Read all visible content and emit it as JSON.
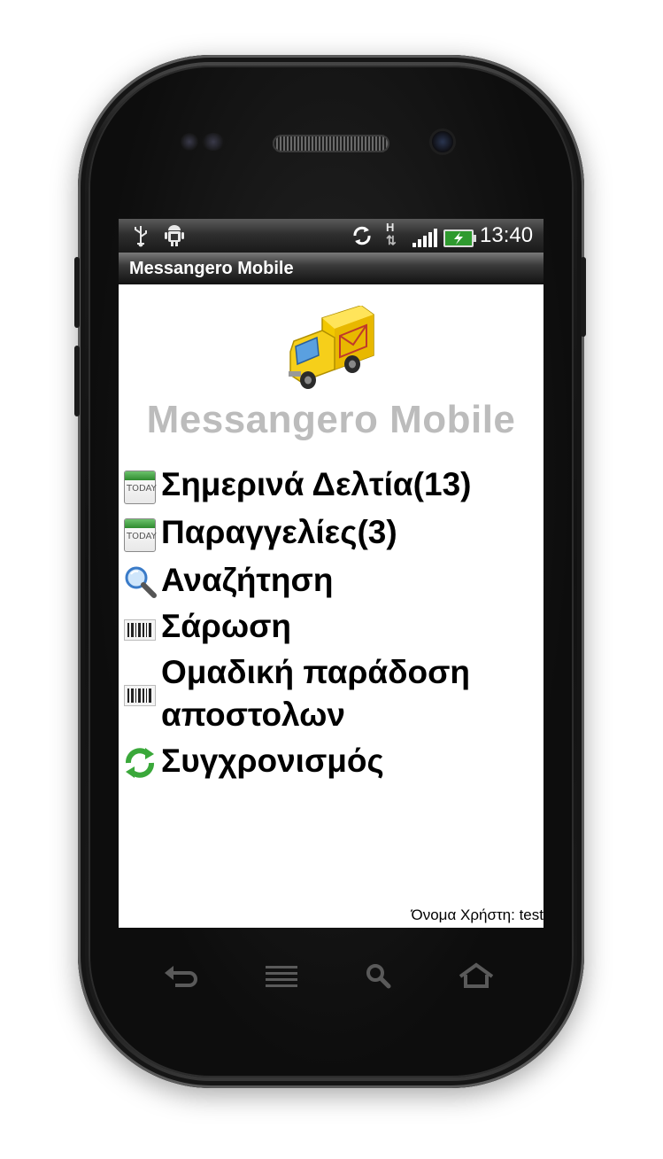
{
  "status_bar": {
    "icons": [
      "usb-icon",
      "android-debug-icon",
      "sync-icon",
      "hspa-icon",
      "signal-icon",
      "battery-icon"
    ],
    "network_type": "H",
    "time": "13:40"
  },
  "title_bar": {
    "title": "Messangero Mobile"
  },
  "header": {
    "app_title": "Messangero Mobile",
    "logo": "delivery-truck-icon"
  },
  "menu": {
    "items": [
      {
        "label": "Σημερινά Δελτία(13)",
        "icon": "calendar-today-icon",
        "icon_text": "TODAY"
      },
      {
        "label": "Παραγγελίες(3)",
        "icon": "calendar-today-icon",
        "icon_text": "TODAY"
      },
      {
        "label": "Αναζήτηση",
        "icon": "search-icon"
      },
      {
        "label": "Σάρωση",
        "icon": "barcode-icon"
      },
      {
        "label": "Ομαδική παράδοση αποστολων",
        "icon": "barcode-icon"
      },
      {
        "label": "Συγχρονισμός",
        "icon": "sync-icon"
      }
    ]
  },
  "footer": {
    "user": "Όνομα Χρήστη: test"
  },
  "nav_keys": [
    "back-icon",
    "menu-icon",
    "search-icon",
    "home-icon"
  ],
  "colors": {
    "app_title": "#bcbcbc",
    "truck_body": "#f2c800",
    "battery": "#2f9a2f"
  }
}
